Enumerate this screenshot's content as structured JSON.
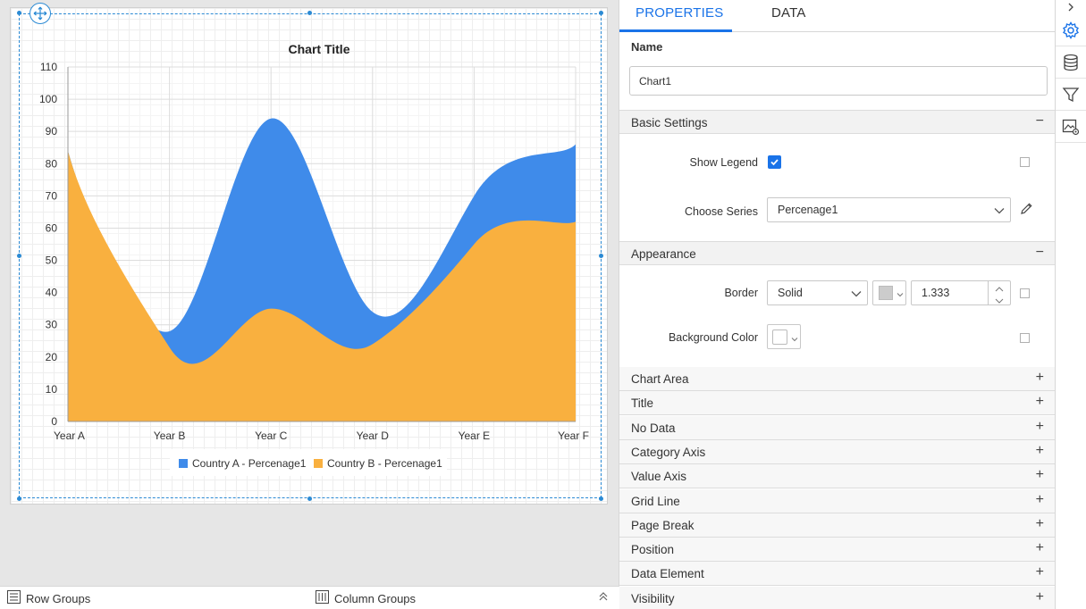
{
  "chart_data": {
    "type": "area",
    "title": "Chart Title",
    "categories": [
      "Year A",
      "Year B",
      "Year C",
      "Year D",
      "Year E",
      "Year F"
    ],
    "y_ticks": [
      0,
      10,
      20,
      30,
      40,
      50,
      60,
      70,
      80,
      90,
      100,
      110
    ],
    "ylim": [
      0,
      110
    ],
    "series": [
      {
        "name": "Country A - Percenage1",
        "color": "#3f8bea",
        "values": [
          84,
          28,
          94,
          34,
          70,
          86
        ]
      },
      {
        "name": "Country B - Percenage1",
        "color": "#f9b03f",
        "values": [
          84,
          23,
          35,
          24,
          55,
          62
        ]
      }
    ],
    "legend_position": "bottom",
    "grid": true
  },
  "tabs": {
    "properties": "PROPERTIES",
    "data": "DATA"
  },
  "name": {
    "label": "Name",
    "value": "Chart1"
  },
  "basic_settings": {
    "title": "Basic Settings",
    "toggle": "−",
    "show_legend_label": "Show Legend",
    "choose_series_label": "Choose Series",
    "choose_series_value": "Percenage1"
  },
  "appearance": {
    "title": "Appearance",
    "toggle": "−",
    "border_label": "Border",
    "border_style": "Solid",
    "border_width": "1.333",
    "background_color_label": "Background Color"
  },
  "sections": [
    {
      "label": "Chart Area",
      "toggle": "+"
    },
    {
      "label": "Title",
      "toggle": "+"
    },
    {
      "label": "No Data",
      "toggle": "+"
    },
    {
      "label": "Category Axis",
      "toggle": "+"
    },
    {
      "label": "Value Axis",
      "toggle": "+"
    },
    {
      "label": "Grid Line",
      "toggle": "+"
    },
    {
      "label": "Page Break",
      "toggle": "+"
    },
    {
      "label": "Position",
      "toggle": "+"
    },
    {
      "label": "Data Element",
      "toggle": "+"
    },
    {
      "label": "Visibility",
      "toggle": "+"
    }
  ],
  "bottom_bar": {
    "row_groups": "Row Groups",
    "column_groups": "Column Groups"
  },
  "colors": {
    "accent": "#1a73e8",
    "selection": "#2b8ad4"
  }
}
